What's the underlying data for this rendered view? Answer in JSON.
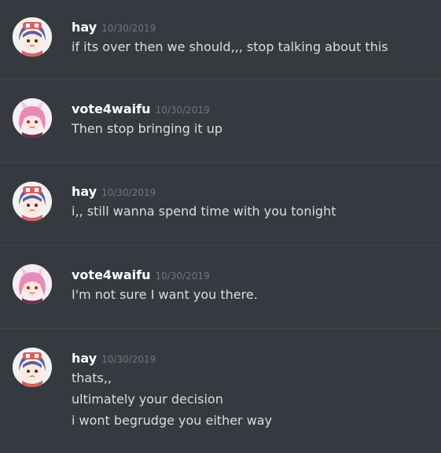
{
  "messages": [
    {
      "author": "hay",
      "timestamp": "10/30/2019",
      "avatar": "hay-avatar",
      "lines": [
        "if its over then we should,,, stop talking about this"
      ]
    },
    {
      "author": "vote4waifu",
      "timestamp": "10/30/2019",
      "avatar": "vote4waifu-avatar",
      "lines": [
        "Then stop bringing it up"
      ]
    },
    {
      "author": "hay",
      "timestamp": "10/30/2019",
      "avatar": "hay-avatar",
      "lines": [
        "i,, still wanna spend time with you tonight"
      ]
    },
    {
      "author": "vote4waifu",
      "timestamp": "10/30/2019",
      "avatar": "vote4waifu-avatar",
      "lines": [
        "I'm not sure I want you there."
      ]
    },
    {
      "author": "hay",
      "timestamp": "10/30/2019",
      "avatar": "hay-avatar",
      "lines": [
        "thats,,",
        "ultimately your decision",
        "i wont begrudge you either way"
      ]
    }
  ],
  "colors": {
    "background": "#36393f",
    "divider": "#42454a",
    "username": "#ffffff",
    "timestamp": "#72767d",
    "text": "#dcddde"
  }
}
